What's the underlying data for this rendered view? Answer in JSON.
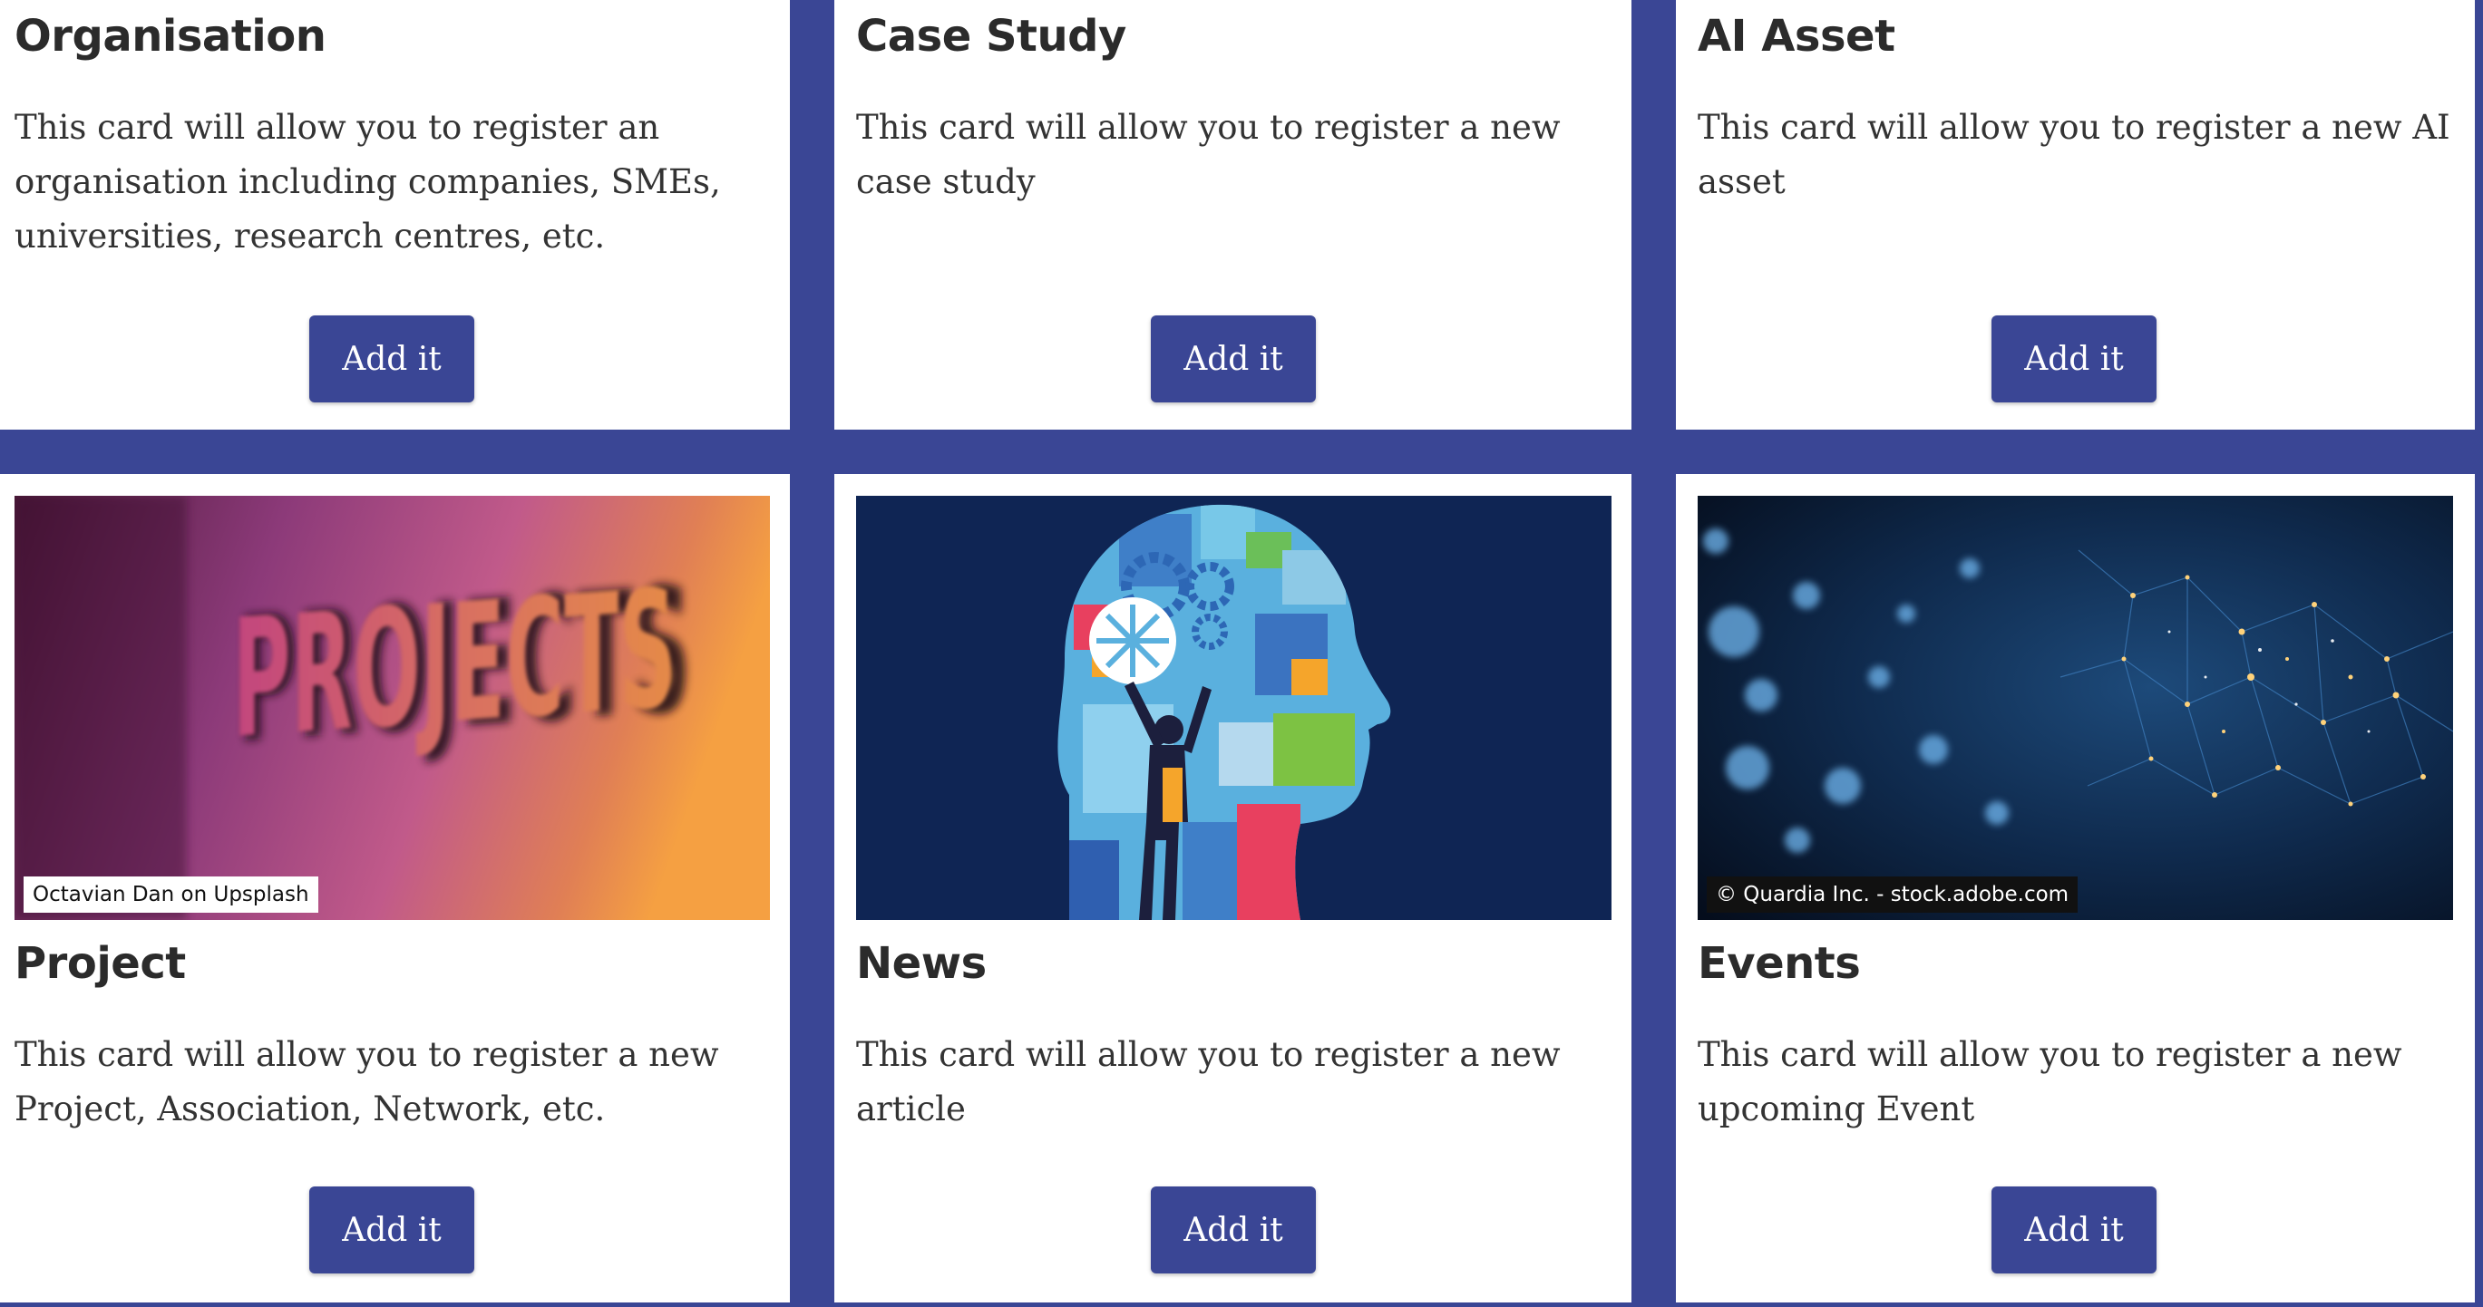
{
  "theme": {
    "brand_color": "#3a4695",
    "card_background": "#ffffff",
    "button_text_color": "#ffffff"
  },
  "cards": [
    {
      "title": "Organisation",
      "description": "This card will allow you to register an organisation including companies, SMEs, universities, research centres, etc.",
      "button_label": "Add it"
    },
    {
      "title": "Case Study",
      "description": "This card will allow you to register a new case study",
      "button_label": "Add it"
    },
    {
      "title": "AI Asset",
      "description": "This card will allow you to register a new AI asset",
      "button_label": "Add it"
    },
    {
      "title": "Project",
      "description": "This card will allow you to register a new Project, Association, Network, etc.",
      "button_label": "Add it",
      "image": {
        "depicts": "projects-sign-photo",
        "caption_text": "PROJECTS",
        "credit": "Octavian Dan on Upsplash"
      }
    },
    {
      "title": "News",
      "description": "This card will allow you to register a new article",
      "button_label": "Add it",
      "image": {
        "depicts": "head-silhouette-gears-illustration"
      }
    },
    {
      "title": "Events",
      "description": "This card will allow you to register a new upcoming Event",
      "button_label": "Add it",
      "image": {
        "depicts": "digital-network-bokeh-photo",
        "credit": "© Quardia Inc. - stock.adobe.com"
      }
    }
  ]
}
